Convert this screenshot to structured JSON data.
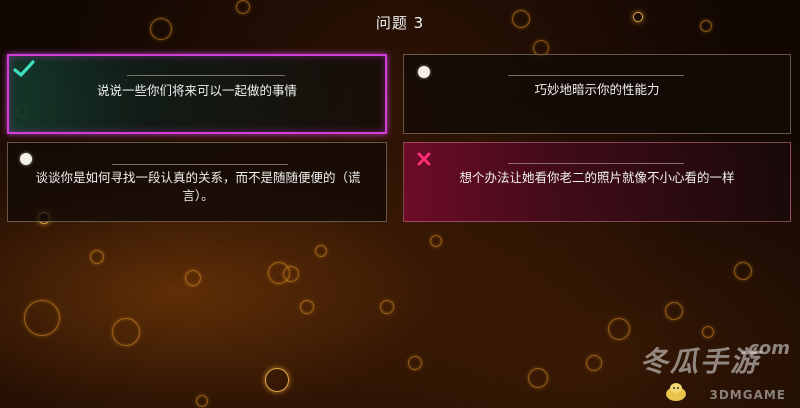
{
  "question": {
    "title": "问题 3"
  },
  "options": [
    {
      "text": "说说一些你们将来可以一起做的事情",
      "state": "correct",
      "indicator": "checkmark-icon"
    },
    {
      "text": "巧妙地暗示你的性能力",
      "state": "neutral",
      "indicator": "dot-icon"
    },
    {
      "text": "谈谈你是如何寻找一段认真的关系，而不是随随便便的（谎言）。",
      "state": "neutral",
      "indicator": "dot-icon"
    },
    {
      "text": "想个办法让她看你老二的照片就像不小心看的一样",
      "state": "wrong",
      "indicator": "cross-icon"
    }
  ],
  "colors": {
    "correct_border": "#d040d8",
    "check": "#3fe0c0",
    "cross": "#ff2d78",
    "bubble": "#e6962a"
  },
  "watermark": {
    "main": "冬瓜手游",
    "domain": ".com",
    "sub": "3DMGAME"
  }
}
